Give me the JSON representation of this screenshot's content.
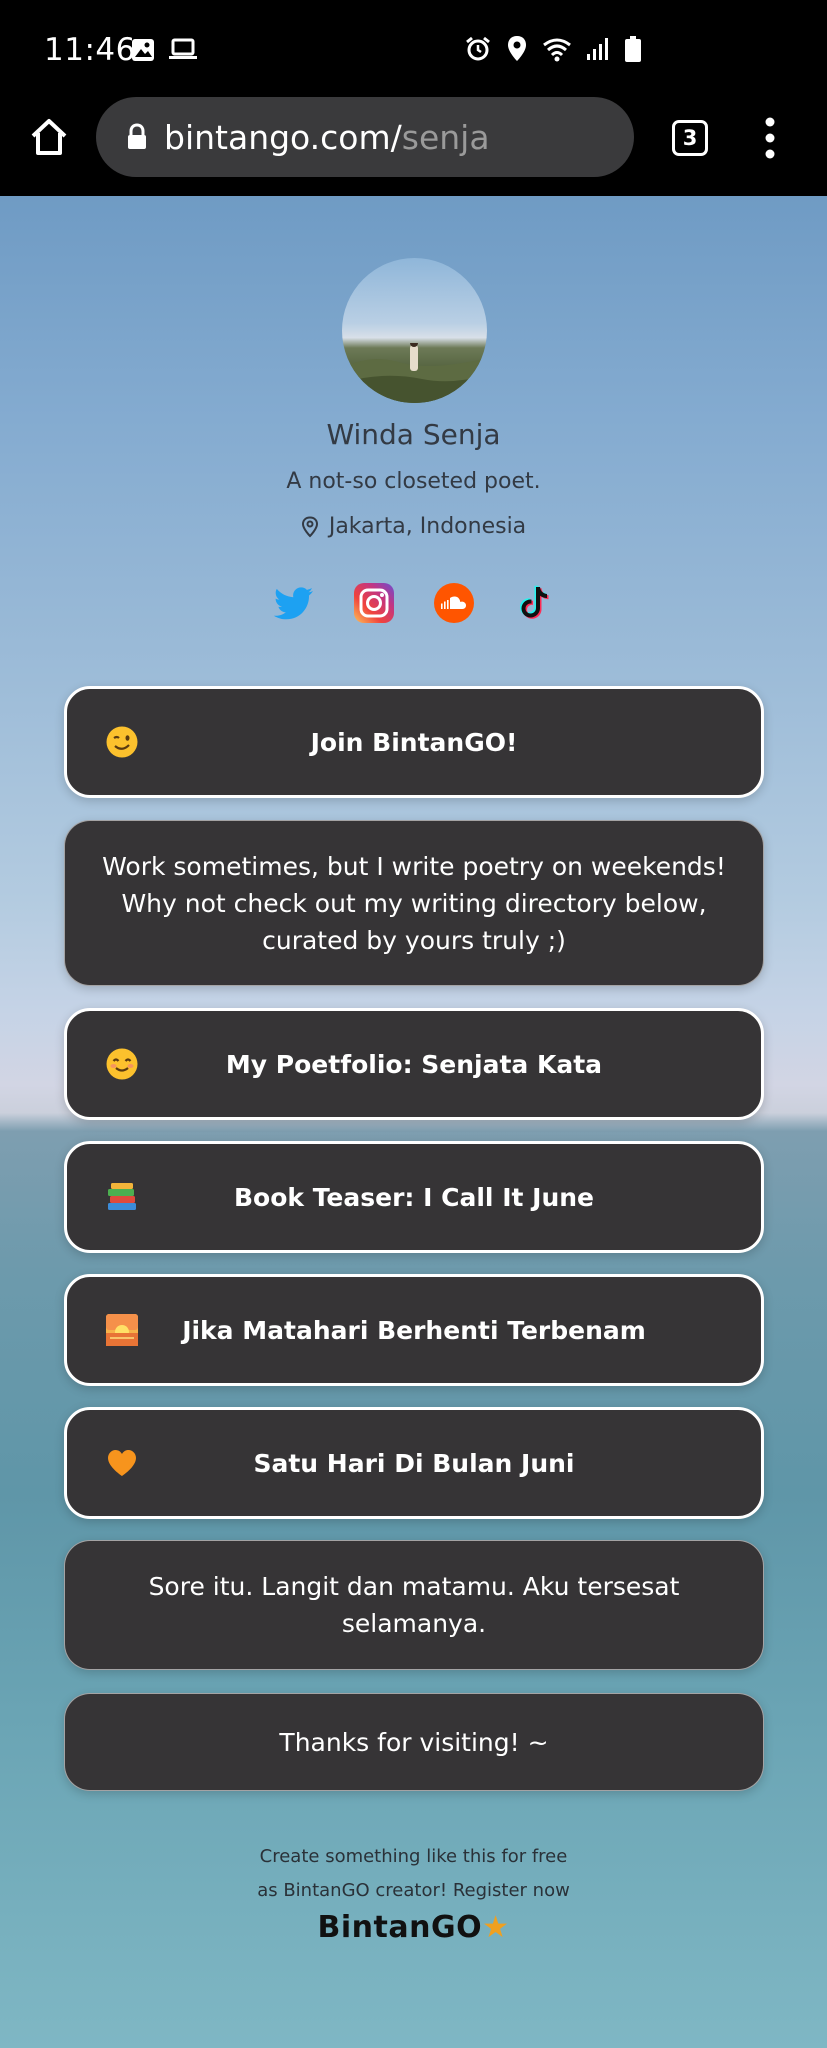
{
  "status_bar": {
    "time": "11:46",
    "left_icons": [
      "image-icon",
      "laptop-icon"
    ],
    "right_icons": [
      "alarm-icon",
      "location-icon",
      "wifi-icon",
      "signal-icon",
      "battery-icon"
    ]
  },
  "browser": {
    "url_host": "bintango.com/",
    "url_path": "senja",
    "tab_count": "3"
  },
  "profile": {
    "name": "Winda Senja",
    "bio": "A not-so closeted poet.",
    "location": "Jakarta, Indonesia"
  },
  "socials": [
    "twitter-icon",
    "instagram-icon",
    "soundcloud-icon",
    "tiktok-icon"
  ],
  "cards": {
    "join": {
      "label": "Join BintanGO!",
      "emoji": "winking-face"
    },
    "intro": {
      "text": "Work sometimes, but I write poetry on weekends! Why not check out my writing directory below, curated by yours truly ;)"
    },
    "poetfolio": {
      "label": "My Poetfolio: Senjata Kata",
      "emoji": "smiling-face"
    },
    "teaser": {
      "label": "Book Teaser: I Call It June",
      "emoji": "books"
    },
    "matahari": {
      "label": "Jika Matahari Berhenti Terbenam",
      "emoji": "sunrise"
    },
    "satu_hari": {
      "label": "Satu Hari Di Bulan Juni",
      "emoji": "orange-heart"
    },
    "sore": {
      "text": "Sore itu. Langit dan matamu. Aku tersesat selamanya."
    },
    "thanks": {
      "text": "Thanks for visiting! ~"
    }
  },
  "footer": {
    "line1": "Create something like this for free",
    "line2": "as BintanGO creator! Register now",
    "logo": "BintanGO"
  },
  "colors": {
    "card_bg": "#363436",
    "card_border": "#ffffff",
    "twitter": "#1da1f2",
    "soundcloud": "#ff5500"
  }
}
